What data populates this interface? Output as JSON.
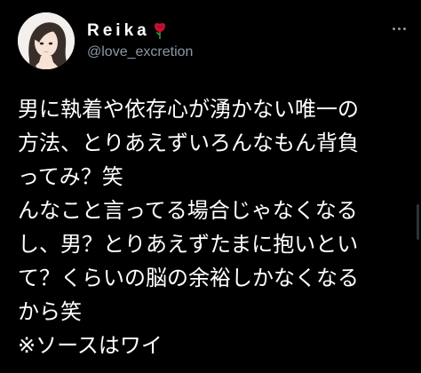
{
  "user": {
    "display_name": "Reika",
    "handle": "@love_excretion"
  },
  "icons": {
    "avatar": "avatar-illustration",
    "name_emoji": "rose-icon",
    "more": "more-options-icon"
  },
  "colors": {
    "background": "#000000",
    "text": "#ffffff",
    "secondary_text": "#8b98a5",
    "rose": "#c8102e"
  },
  "tweet": {
    "lines": [
      "男に執着や依存心が湧かない唯一の",
      "方法、とりあえずいろんなもん背負",
      "ってみ？笑",
      "んなこと言ってる場合じゃなくなる",
      "し、男？とりあえずたまに抱いとい",
      "て？くらいの脳の余裕しかなくなる",
      "から笑",
      "※ソースはワイ"
    ]
  }
}
